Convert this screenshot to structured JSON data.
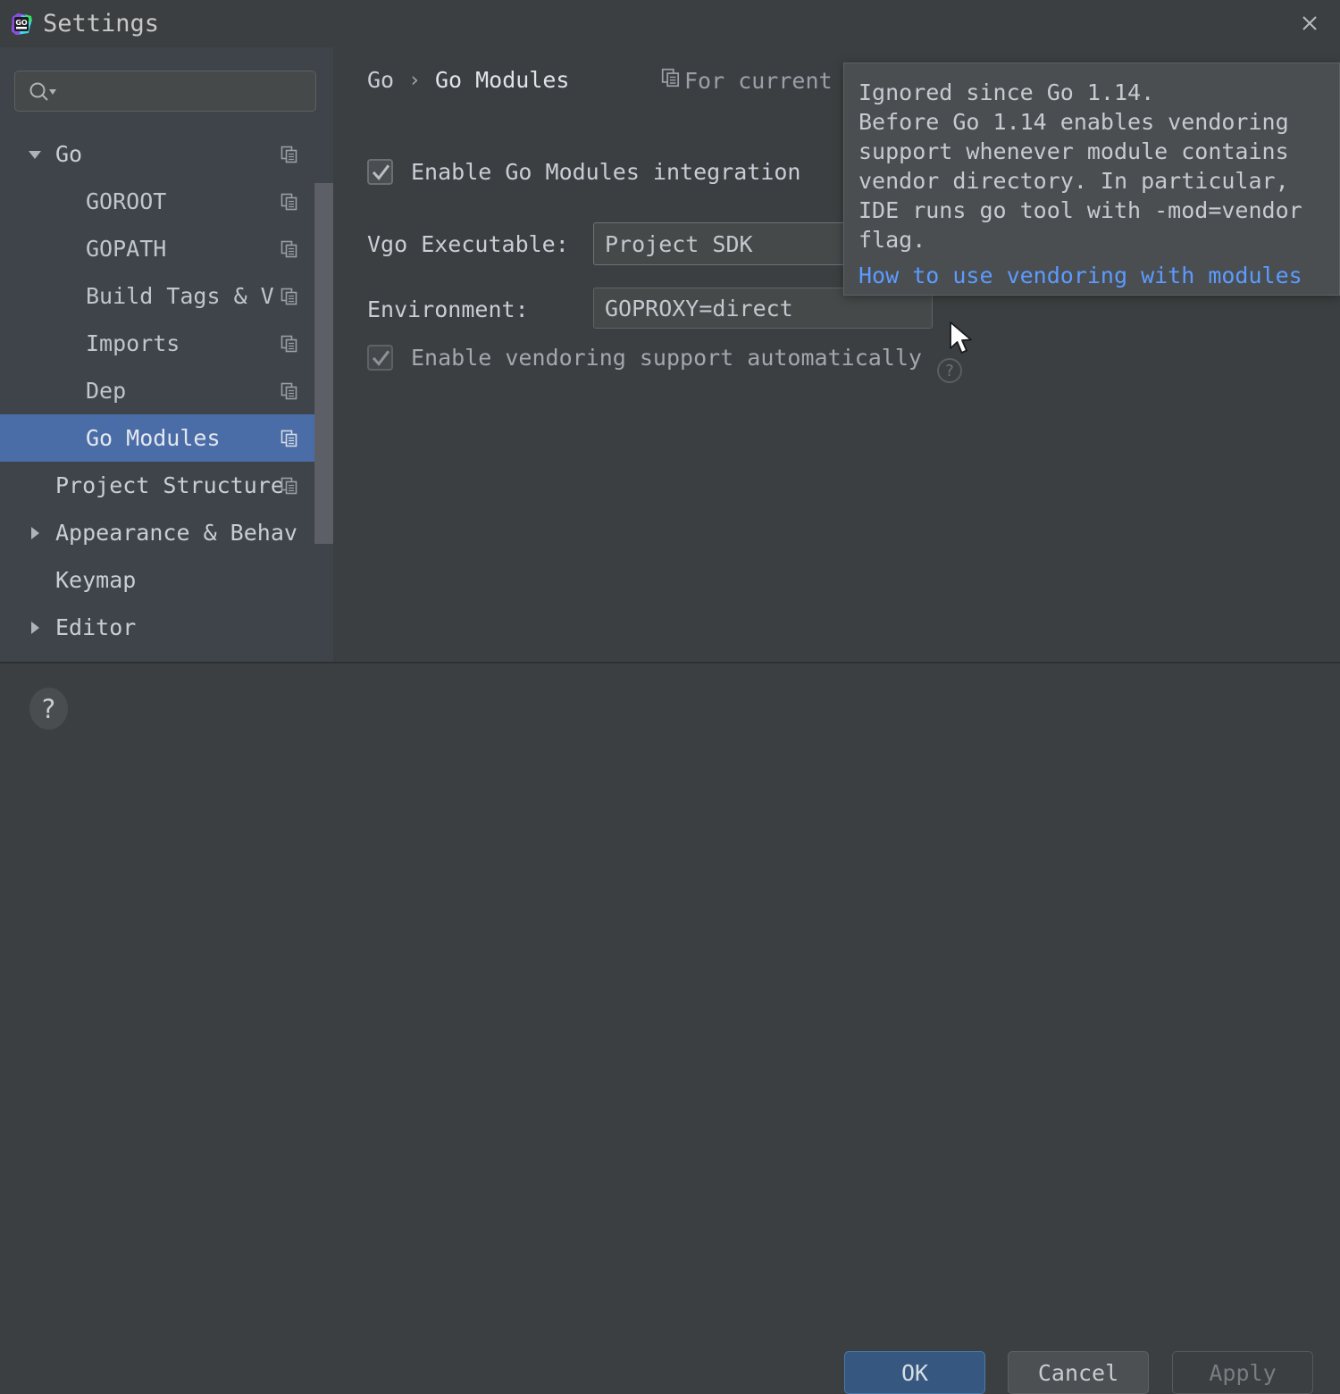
{
  "window": {
    "title": "Settings",
    "logo_icon": "goland-logo-icon",
    "close_icon": "close-icon"
  },
  "sidebar": {
    "search": {
      "value": "",
      "placeholder": "",
      "icon": "search-icon"
    },
    "scrollbar": "vertical-scrollbar",
    "items": [
      {
        "label": "Go",
        "level": 0,
        "arrow": "expanded",
        "selected": false,
        "copy_icon": "copy-icon"
      },
      {
        "label": "GOROOT",
        "level": 1,
        "arrow": "none",
        "selected": false,
        "copy_icon": "copy-icon"
      },
      {
        "label": "GOPATH",
        "level": 1,
        "arrow": "none",
        "selected": false,
        "copy_icon": "copy-icon"
      },
      {
        "label": "Build Tags & V",
        "level": 1,
        "arrow": "none",
        "selected": false,
        "copy_icon": "copy-icon"
      },
      {
        "label": "Imports",
        "level": 1,
        "arrow": "none",
        "selected": false,
        "copy_icon": "copy-icon"
      },
      {
        "label": "Dep",
        "level": 1,
        "arrow": "none",
        "selected": false,
        "copy_icon": "copy-icon"
      },
      {
        "label": "Go Modules",
        "level": 1,
        "arrow": "none",
        "selected": true,
        "copy_icon": "copy-icon"
      },
      {
        "label": "Project Structure",
        "level": 0,
        "arrow": "none",
        "selected": false,
        "copy_icon": "copy-icon"
      },
      {
        "label": "Appearance & Behav",
        "level": 0,
        "arrow": "collapsed",
        "selected": false,
        "copy_icon": ""
      },
      {
        "label": "Keymap",
        "level": 0,
        "arrow": "none",
        "selected": false,
        "copy_icon": ""
      },
      {
        "label": "Editor",
        "level": 0,
        "arrow": "collapsed",
        "selected": false,
        "copy_icon": ""
      }
    ]
  },
  "main": {
    "breadcrumb": {
      "root": "Go",
      "separator": "›",
      "current": "Go Modules"
    },
    "for_current": {
      "label": "For current",
      "icon": "copy-icon"
    },
    "enable_modules": {
      "label": "Enable Go Modules integration",
      "checked": true
    },
    "vgo_executable": {
      "label": "Vgo Executable:",
      "value": "Project SDK"
    },
    "environment": {
      "label": "Environment:",
      "value": "GOPROXY=direct"
    },
    "enable_vendoring": {
      "label": "Enable vendoring support automatically",
      "checked": true,
      "help_icon": "question-mark-icon",
      "help_glyph": "?"
    }
  },
  "tooltip": {
    "lines": [
      "Ignored since Go 1.14.",
      "Before Go 1.14 enables vendoring",
      "support whenever module contains",
      "vendor directory. In particular,",
      "IDE runs go tool with -mod=vendor",
      "flag."
    ],
    "link": "How to use vendoring with modules",
    "link_color": "#5b9bff"
  },
  "cursor": {
    "icon": "mouse-pointer-icon"
  },
  "bottom": {
    "help_glyph": "?",
    "help_icon": "help-circle-icon",
    "ok_label": "OK",
    "cancel_label": "Cancel",
    "apply_label": "Apply",
    "ok_color": "#365880"
  }
}
